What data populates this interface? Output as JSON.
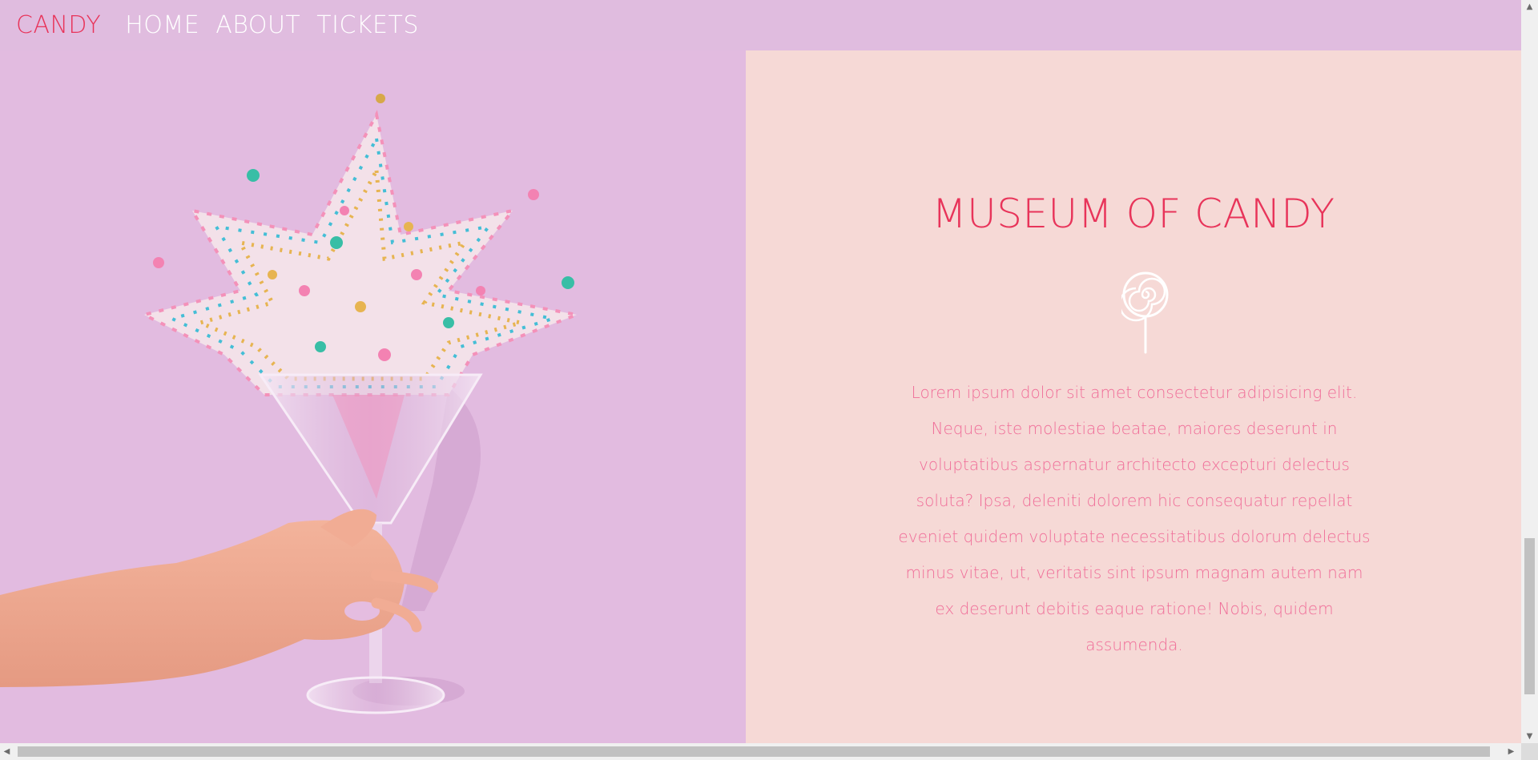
{
  "nav": {
    "brand": "CANDY",
    "links": [
      "HOME",
      "ABOUT",
      "TICKETS"
    ]
  },
  "info": {
    "title": "MUSEUM OF CANDY",
    "icon": "lollipop-icon",
    "text": "Lorem ipsum dolor sit amet consectetur adipisicing elit. Neque, iste molestiae beatae, maiores deserunt in voluptatibus aspernatur architecto excepturi delectus soluta? Ipsa, deleniti dolorem hic consequatur repellat eveniet quidem voluptate necessitatibus dolorum delectus minus vitae, ut, veritatis sint ipsum magnam autem nam ex deserunt debitis eaque ratione! Nobis, quidem assumenda."
  },
  "colors": {
    "accent": "#e8345a",
    "nav_bg": "#e0bcdf",
    "panel_bg": "#f6d9d6",
    "text_pink": "#f06d98"
  },
  "image": {
    "subject": "hand holding martini glass bursting with candy sprinkles"
  }
}
